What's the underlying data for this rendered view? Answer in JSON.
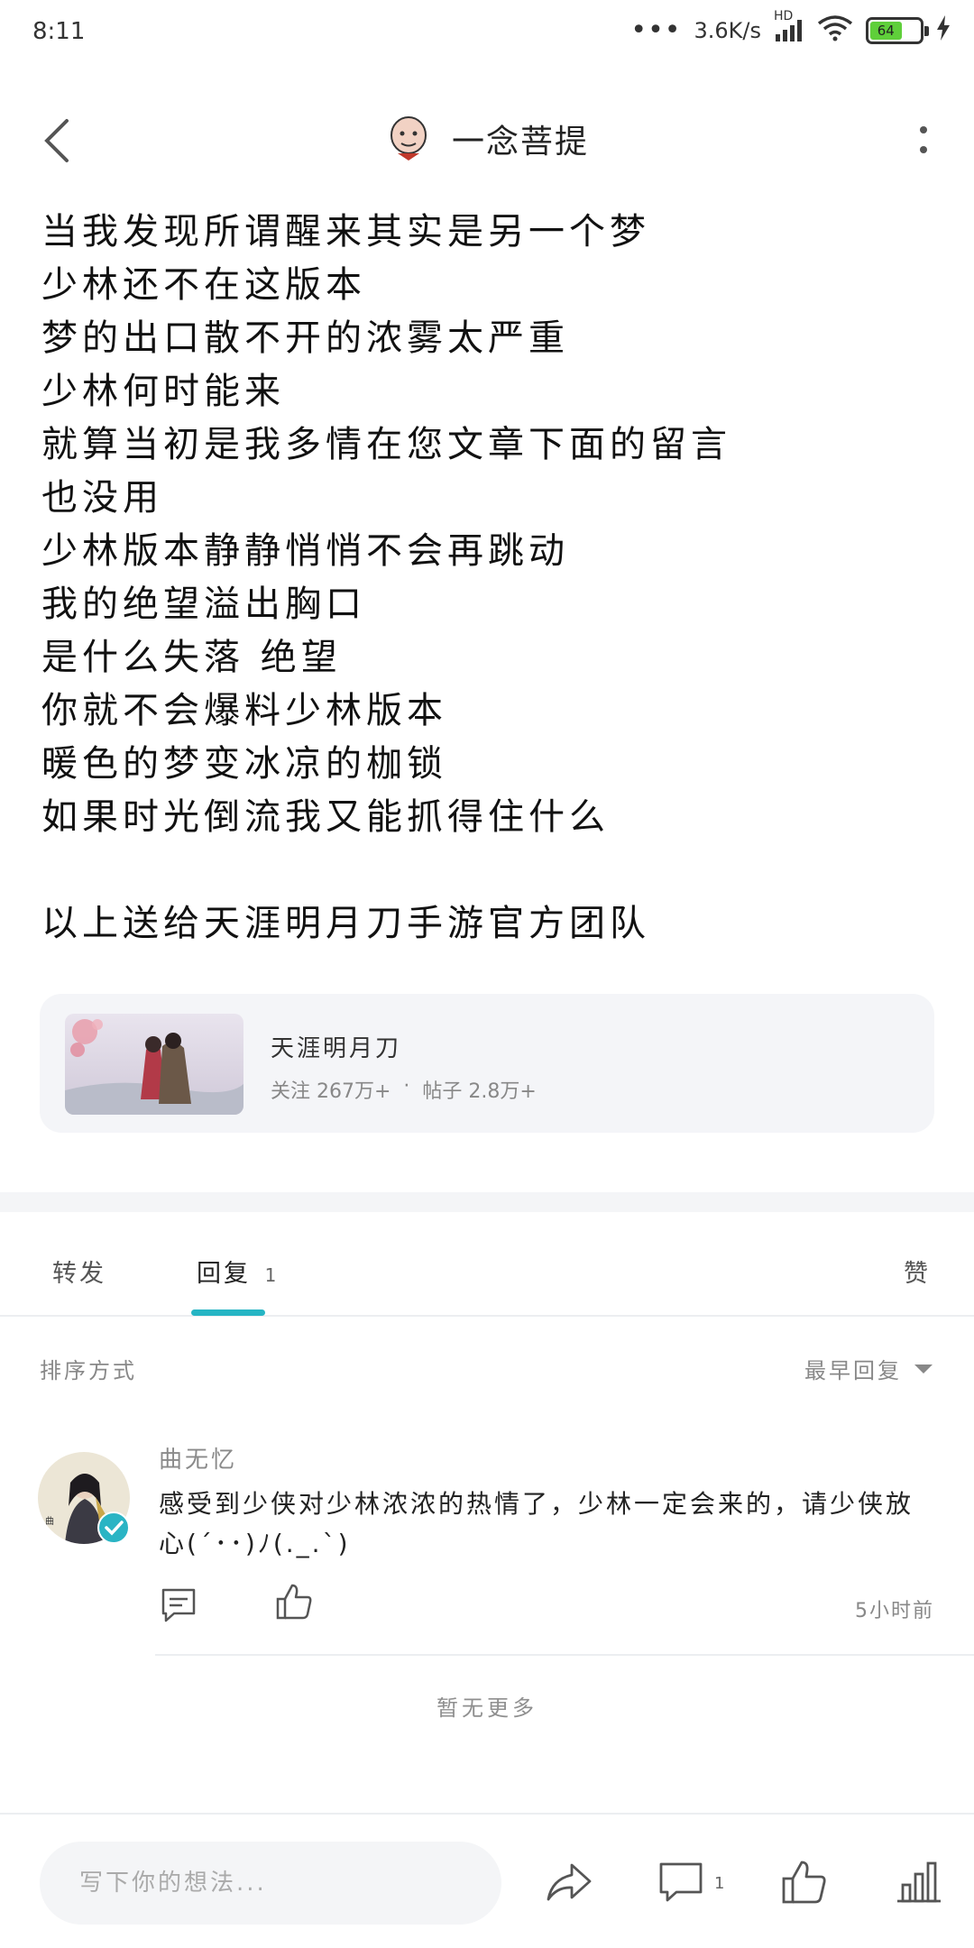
{
  "status_bar": {
    "time": "8:11",
    "network_speed": "3.6K/s",
    "network_type": "HD",
    "battery_level": "64"
  },
  "header": {
    "title": "一念菩提"
  },
  "post": {
    "lines": [
      "当我发现所谓醒来其实是另一个梦",
      "少林还不在这版本",
      "梦的出口散不开的浓雾太严重",
      "少林何时能来",
      "就算当初是我多情在您文章下面的留言",
      "也没用",
      "少林版本静静悄悄不会再跳动",
      "我的绝望溢出胸口",
      "是什么失落 绝望",
      "你就不会爆料少林版本",
      "暖色的梦变冰凉的枷锁",
      "如果时光倒流我又能抓得住什么",
      "",
      "以上送给天涯明月刀手游官方团队"
    ]
  },
  "forum_card": {
    "name": "天涯明月刀",
    "followers": "关注 267万+",
    "separator": "·",
    "posts": "帖子 2.8万+"
  },
  "tabs": [
    {
      "label": "转发"
    },
    {
      "label": "回复",
      "count": "1"
    },
    {
      "label": "赞"
    }
  ],
  "sort": {
    "label": "排序方式",
    "selected": "最早回复"
  },
  "comments": [
    {
      "user": "曲无忆",
      "text": "感受到少侠对少林浓浓的热情了，少林一定会来的，请少侠放心(´･･)ﾉ(._.`)",
      "time": "5小时前"
    }
  ],
  "no_more_text": "暂无更多",
  "bottom_bar": {
    "input_placeholder": "写下你的想法...",
    "comment_count": "1"
  },
  "colors": {
    "accent": "#26b5c4",
    "battery": "#5fcf3a"
  }
}
